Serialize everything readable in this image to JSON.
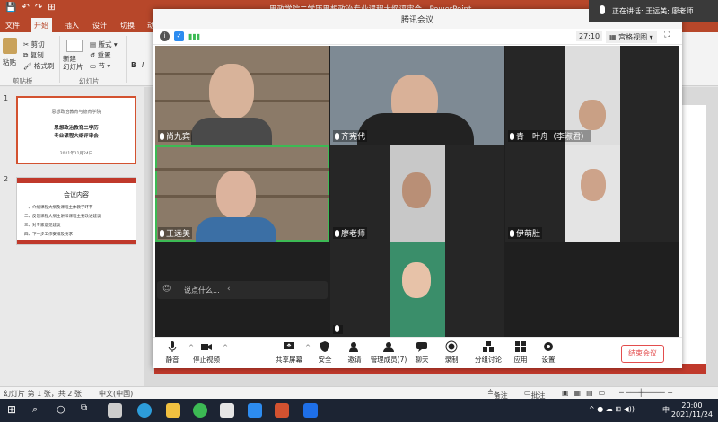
{
  "ppt": {
    "title": "思政学院二学历思想政治专业课程大纲评审会  -  PowerPoint",
    "tabs": [
      "文件",
      "开始",
      "插入",
      "设计",
      "切换",
      "动画"
    ],
    "active_tab": "开始",
    "ribbon": {
      "paste": "粘贴",
      "cut": "剪切",
      "copy": "复制",
      "format_painter": "格式刷",
      "clipboard_group": "剪贴板",
      "new_slide": "新建\n幻灯片",
      "layout": "版式",
      "reset": "重置",
      "section": "节",
      "slides_group": "幻灯片"
    },
    "slides": [
      {
        "num": "1",
        "line1": "思想政治教育与德育学院",
        "line2": "思想政治教育二学历\n专业课程大纲评审会",
        "line3": "2021年11月24日"
      },
      {
        "num": "2",
        "title": "会议内容",
        "items": [
          "一、介绍课程大纲及课程主体教学环节",
          "二、反馈课程大纲主讲和课程主要改进建议",
          "三、对专家意见建议",
          "四、下一步工作安排及要求"
        ]
      }
    ],
    "status": {
      "slide_info": "幻灯片 第 1 张，共 2 张",
      "language": "中文(中国)",
      "notes": "备注",
      "comments": "批注"
    }
  },
  "meeting": {
    "window_title": "腾讯会议",
    "timer": "27:10",
    "view_label": "宫格视图",
    "speaking": "正在讲话: 王远美; 廖老师...",
    "participants": [
      {
        "name": "尚九宾"
      },
      {
        "name": "齐宪代"
      },
      {
        "name": "青一叶舟（李淑君）"
      },
      {
        "name": "王远美"
      },
      {
        "name": "廖老师"
      },
      {
        "name": "伊萌肚"
      },
      {
        "name": ""
      }
    ],
    "chat_placeholder": "说点什么...",
    "toolbar": {
      "mute": "静音",
      "stop_video": "停止视频",
      "share": "共享屏幕",
      "security": "安全",
      "invite": "邀请",
      "manage": "管理成员(7)",
      "chat": "聊天",
      "record": "录制",
      "breakout": "分组讨论",
      "apps": "应用",
      "settings": "设置",
      "end": "结束会议"
    }
  },
  "taskbar": {
    "time": "20:00",
    "date": "2021/11/24",
    "ime": "中"
  },
  "colors": {
    "ppt_red": "#b7472a",
    "active_green": "#3cba54",
    "end_red": "#e34d4d"
  }
}
